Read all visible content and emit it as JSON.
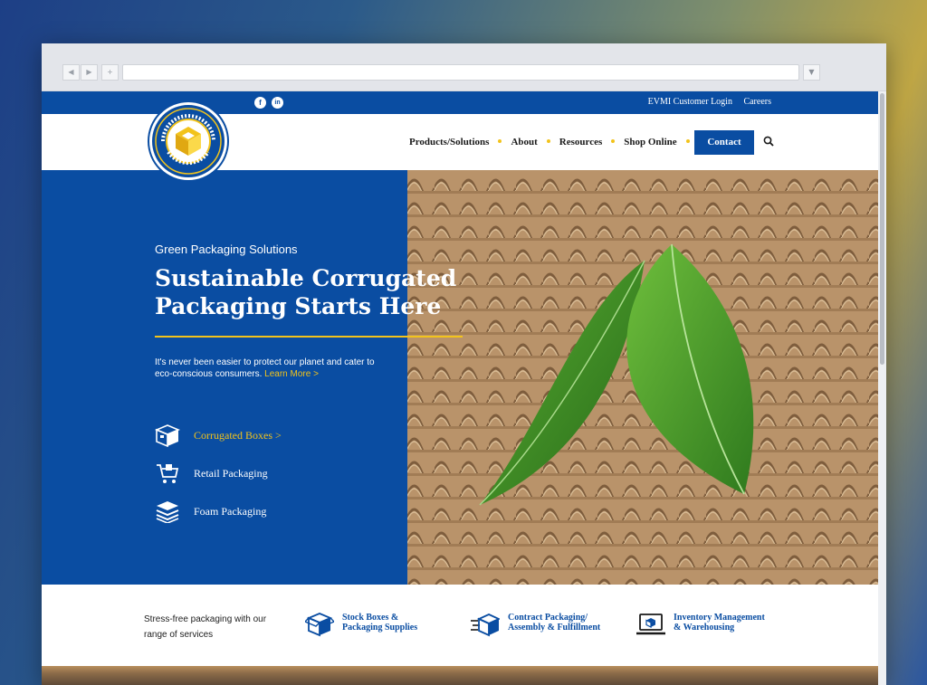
{
  "browser": {
    "back_glyph": "◀",
    "forward_glyph": "▶",
    "new_tab_glyph": "+",
    "dropdown_glyph": "▼"
  },
  "topbar": {
    "social_facebook": "f",
    "social_linkedin": "in",
    "links": [
      "EVMI Customer Login",
      "Careers"
    ]
  },
  "header": {
    "nav": [
      "Products/Solutions",
      "About",
      "Resources",
      "Shop Online"
    ],
    "contact_label": "Contact"
  },
  "hero": {
    "eyebrow": "Green Packaging Solutions",
    "headline_line1": "Sustainable Corrugated",
    "headline_line2": "Packaging Starts Here",
    "description": "It's never been easier to protect our planet and cater to eco-conscious consumers.",
    "learn_more": "Learn More >",
    "services": [
      {
        "label": "Corrugated Boxes >",
        "icon": "box-icon"
      },
      {
        "label": "Retail Packaging",
        "icon": "cart-icon"
      },
      {
        "label": "Foam Packaging",
        "icon": "foam-stack-icon"
      }
    ]
  },
  "strip": {
    "intro": "Stress-free packaging with our range of services",
    "items": [
      {
        "line1": "Stock Boxes &",
        "line2": "Packaging Supplies",
        "icon": "stock-boxes-icon"
      },
      {
        "line1": "Contract Packaging/",
        "line2": "Assembly & Fulfillment",
        "icon": "contract-packaging-icon"
      },
      {
        "line1": "Inventory Management",
        "line2": "& Warehousing",
        "icon": "inventory-laptop-icon"
      }
    ]
  },
  "colors": {
    "brand_blue": "#0a4da2",
    "accent_yellow": "#f2c31b",
    "cardboard": "#b9936a",
    "leaf_green": "#4e9a2e"
  }
}
